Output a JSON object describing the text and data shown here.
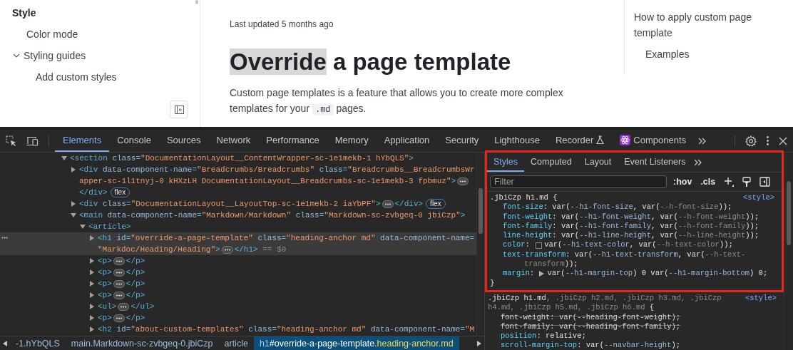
{
  "sidebar": {
    "section": "Style",
    "items": [
      {
        "label": "Color mode",
        "kind": "link"
      },
      {
        "label": "Styling guides",
        "kind": "group",
        "expanded": true,
        "children": [
          {
            "label": "Add custom styles"
          }
        ]
      }
    ]
  },
  "page": {
    "updated": "Last updated 5 months ago",
    "title_parts": [
      {
        "text": "Override",
        "selected": true
      },
      {
        "text": " a page template",
        "selected": false
      }
    ],
    "intro": [
      {
        "kind": "text",
        "text": "Custom page templates is a feature that allows you to create more complex templates for your "
      },
      {
        "kind": "code",
        "text": ".md"
      },
      {
        "kind": "text",
        "text": " pages."
      }
    ]
  },
  "toc": [
    {
      "label": "How to apply custom page template",
      "children": [
        {
          "label": "Examples"
        }
      ]
    }
  ],
  "devtools": {
    "tabs": [
      {
        "label": "Elements",
        "kind": "text",
        "selected": true
      },
      {
        "label": "Console",
        "kind": "text",
        "selected": false
      },
      {
        "label": "Sources",
        "kind": "text",
        "selected": false
      },
      {
        "label": "Network",
        "kind": "text",
        "selected": false
      },
      {
        "label": "Performance",
        "kind": "text",
        "selected": false
      },
      {
        "label": "Memory",
        "kind": "text",
        "selected": false
      },
      {
        "label": "Application",
        "kind": "text",
        "selected": false
      },
      {
        "label": "Security",
        "kind": "text",
        "selected": false
      },
      {
        "label": "Lighthouse",
        "kind": "text",
        "selected": false
      },
      {
        "label": "Recorder",
        "kind": "experimental",
        "selected": false
      },
      {
        "label": "Components",
        "kind": "extension",
        "selected": false
      }
    ],
    "tree": [
      {
        "expanded": true,
        "selected": false,
        "lines": [
          [
            {
              "kind": "tag",
              "text": "<section"
            },
            {
              "kind": "attr",
              "text": " class"
            },
            {
              "kind": "tag",
              "text": "="
            },
            {
              "kind": "value",
              "text": "\"DocumentationLayout__ContentWrapper-sc-1e1mekb-1 hYbQLS\""
            },
            {
              "kind": "tag",
              "text": ">"
            }
          ]
        ],
        "children": [
          {
            "expanded": false,
            "selected": false,
            "lines": [
              [
                {
                  "kind": "tag",
                  "text": "<div"
                },
                {
                  "kind": "attr",
                  "text": " data-component-name"
                },
                {
                  "kind": "tag",
                  "text": "="
                },
                {
                  "kind": "value",
                  "text": "\"Breadcrumbs/Breadcrumbs\""
                },
                {
                  "kind": "attr",
                  "text": " class"
                },
                {
                  "kind": "tag",
                  "text": "="
                },
                {
                  "kind": "value",
                  "text": "\"Breadcrumbs__BreadcrumbsWr"
                }
              ],
              [
                {
                  "kind": "value",
                  "text": "apper-sc-1l1tnyj-0 kHXzLH DocumentationLayout__Breadcrumbs-sc-1e1mekb-3 fpbmuz\""
                },
                {
                  "kind": "tag",
                  "text": ">"
                },
                {
                  "kind": "ellipsis"
                }
              ],
              [
                {
                  "kind": "tag",
                  "text": "</div>"
                },
                {
                  "kind": "badge",
                  "text": "flex"
                }
              ]
            ]
          },
          {
            "expanded": false,
            "selected": false,
            "lines": [
              [
                {
                  "kind": "tag",
                  "text": "<div"
                },
                {
                  "kind": "attr",
                  "text": " class"
                },
                {
                  "kind": "tag",
                  "text": "="
                },
                {
                  "kind": "value",
                  "text": "\"DocumentationLayout__LayoutTop-sc-1e1mekb-2 iaYbPF\""
                },
                {
                  "kind": "tag",
                  "text": ">"
                },
                {
                  "kind": "ellipsis"
                },
                {
                  "kind": "tag",
                  "text": "</div>"
                },
                {
                  "kind": "badge",
                  "text": "flex"
                }
              ]
            ]
          },
          {
            "expanded": true,
            "selected": false,
            "lines": [
              [
                {
                  "kind": "tag",
                  "text": "<main"
                },
                {
                  "kind": "attr",
                  "text": " data-component-name"
                },
                {
                  "kind": "tag",
                  "text": "="
                },
                {
                  "kind": "value",
                  "text": "\"Markdown/Markdown\""
                },
                {
                  "kind": "attr",
                  "text": " class"
                },
                {
                  "kind": "tag",
                  "text": "="
                },
                {
                  "kind": "value",
                  "text": "\"Markdown-sc-zvbgeq-0 jbiCzp\""
                },
                {
                  "kind": "tag",
                  "text": ">"
                }
              ]
            ],
            "children": [
              {
                "expanded": true,
                "selected": false,
                "lines": [
                  [
                    {
                      "kind": "tag",
                      "text": "<article>"
                    }
                  ]
                ],
                "children": [
                  {
                    "expanded": false,
                    "selected": true,
                    "lines": [
                      [
                        {
                          "kind": "tag",
                          "text": "<h1"
                        },
                        {
                          "kind": "attr",
                          "text": " id"
                        },
                        {
                          "kind": "tag",
                          "text": "="
                        },
                        {
                          "kind": "value",
                          "text": "\"override-a-page-template\""
                        },
                        {
                          "kind": "attr",
                          "text": " class"
                        },
                        {
                          "kind": "tag",
                          "text": "="
                        },
                        {
                          "kind": "value",
                          "text": "\"heading-anchor md\""
                        },
                        {
                          "kind": "attr",
                          "text": " data-component-name"
                        },
                        {
                          "kind": "tag",
                          "text": "="
                        }
                      ],
                      [
                        {
                          "kind": "value",
                          "text": "\"Markdoc/Heading/Heading\""
                        },
                        {
                          "kind": "tag",
                          "text": ">"
                        },
                        {
                          "kind": "ellipsis"
                        },
                        {
                          "kind": "tag",
                          "text": "</h1>"
                        },
                        {
                          "kind": "dim",
                          "text": " == $0"
                        }
                      ]
                    ]
                  },
                  {
                    "expanded": false,
                    "selected": false,
                    "lines": [
                      [
                        {
                          "kind": "tag",
                          "text": "<p>"
                        },
                        {
                          "kind": "ellipsis"
                        },
                        {
                          "kind": "tag",
                          "text": "</p>"
                        }
                      ]
                    ]
                  },
                  {
                    "expanded": false,
                    "selected": false,
                    "lines": [
                      [
                        {
                          "kind": "tag",
                          "text": "<p>"
                        },
                        {
                          "kind": "ellipsis"
                        },
                        {
                          "kind": "tag",
                          "text": "</p>"
                        }
                      ]
                    ]
                  },
                  {
                    "expanded": false,
                    "selected": false,
                    "lines": [
                      [
                        {
                          "kind": "tag",
                          "text": "<p>"
                        },
                        {
                          "kind": "ellipsis"
                        },
                        {
                          "kind": "tag",
                          "text": "</p>"
                        }
                      ]
                    ]
                  },
                  {
                    "expanded": false,
                    "selected": false,
                    "lines": [
                      [
                        {
                          "kind": "tag",
                          "text": "<p>"
                        },
                        {
                          "kind": "ellipsis"
                        },
                        {
                          "kind": "tag",
                          "text": "</p>"
                        }
                      ]
                    ]
                  },
                  {
                    "expanded": false,
                    "selected": false,
                    "lines": [
                      [
                        {
                          "kind": "tag",
                          "text": "<ul>"
                        },
                        {
                          "kind": "ellipsis"
                        },
                        {
                          "kind": "tag",
                          "text": "</ul>"
                        }
                      ]
                    ]
                  },
                  {
                    "expanded": false,
                    "selected": false,
                    "lines": [
                      [
                        {
                          "kind": "tag",
                          "text": "<p>"
                        },
                        {
                          "kind": "ellipsis"
                        },
                        {
                          "kind": "tag",
                          "text": "</p>"
                        }
                      ]
                    ]
                  },
                  {
                    "expanded": false,
                    "selected": false,
                    "lines": [
                      [
                        {
                          "kind": "tag",
                          "text": "<h2"
                        },
                        {
                          "kind": "attr",
                          "text": " id"
                        },
                        {
                          "kind": "tag",
                          "text": "="
                        },
                        {
                          "kind": "value",
                          "text": "\"about-custom-templates\""
                        },
                        {
                          "kind": "attr",
                          "text": " class"
                        },
                        {
                          "kind": "tag",
                          "text": "="
                        },
                        {
                          "kind": "value",
                          "text": "\"heading-anchor md\""
                        },
                        {
                          "kind": "attr",
                          "text": " data-component-name"
                        },
                        {
                          "kind": "tag",
                          "text": "="
                        },
                        {
                          "kind": "value",
                          "text": "\"M"
                        }
                      ]
                    ]
                  }
                ]
              }
            ]
          }
        ]
      }
    ],
    "breadcrumbs": [
      {
        "selected": false,
        "parts": [
          {
            "kind": "cls",
            "text": "-1.hYbQLS"
          }
        ]
      },
      {
        "selected": false,
        "parts": [
          {
            "kind": "tag",
            "text": "main"
          },
          {
            "kind": "cls",
            "text": ".Markdown-sc-zvbgeq-0.jbiCzp"
          }
        ]
      },
      {
        "selected": false,
        "parts": [
          {
            "kind": "tag",
            "text": "article"
          }
        ]
      },
      {
        "selected": true,
        "parts": [
          {
            "kind": "tag",
            "text": "h1"
          },
          {
            "kind": "id",
            "text": "#override-a-page-template"
          },
          {
            "kind": "cls",
            "text": ".heading-anchor.md"
          }
        ]
      }
    ],
    "styles": {
      "highlighted": true,
      "tabs": [
        {
          "label": "Styles",
          "selected": true
        },
        {
          "label": "Computed",
          "selected": false
        },
        {
          "label": "Layout",
          "selected": false
        },
        {
          "label": "Event Listeners",
          "selected": false
        }
      ],
      "filter": {
        "placeholder": "Filter"
      },
      "actions": [
        ":hov",
        ".cls"
      ],
      "rules": [
        {
          "source": "<style>",
          "selector_lines": [
            [
              {
                "kind": "match",
                "text": ".jbiCzp h1.md"
              },
              {
                "kind": "text",
                "text": " {"
              }
            ]
          ],
          "closing": "}",
          "declarations": [
            {
              "overridden": false,
              "lines": [
                [
                  {
                    "kind": "prop",
                    "text": "font-size"
                  },
                  {
                    "kind": "text",
                    "text": ": var("
                  },
                  {
                    "kind": "var",
                    "text": "--h1-font-size"
                  },
                  {
                    "kind": "text",
                    "text": ", var("
                  },
                  {
                    "kind": "dim",
                    "text": "--h-font-size"
                  },
                  {
                    "kind": "text",
                    "text": "));"
                  }
                ]
              ]
            },
            {
              "overridden": false,
              "lines": [
                [
                  {
                    "kind": "prop",
                    "text": "font-weight"
                  },
                  {
                    "kind": "text",
                    "text": ": var("
                  },
                  {
                    "kind": "var",
                    "text": "--h1-font-weight"
                  },
                  {
                    "kind": "text",
                    "text": ", var("
                  },
                  {
                    "kind": "dim",
                    "text": "--h-font-weight"
                  },
                  {
                    "kind": "text",
                    "text": "));"
                  }
                ]
              ]
            },
            {
              "overridden": false,
              "lines": [
                [
                  {
                    "kind": "prop",
                    "text": "font-family"
                  },
                  {
                    "kind": "text",
                    "text": ": var("
                  },
                  {
                    "kind": "var",
                    "text": "--h1-font-family"
                  },
                  {
                    "kind": "text",
                    "text": ", var("
                  },
                  {
                    "kind": "dim",
                    "text": "--h-font-family"
                  },
                  {
                    "kind": "text",
                    "text": "));"
                  }
                ]
              ]
            },
            {
              "overridden": false,
              "lines": [
                [
                  {
                    "kind": "prop",
                    "text": "line-height"
                  },
                  {
                    "kind": "text",
                    "text": ": var("
                  },
                  {
                    "kind": "var",
                    "text": "--h1-line-height"
                  },
                  {
                    "kind": "text",
                    "text": ", var("
                  },
                  {
                    "kind": "dim",
                    "text": "--h-line-height"
                  },
                  {
                    "kind": "text",
                    "text": "));"
                  }
                ]
              ]
            },
            {
              "overridden": false,
              "lines": [
                [
                  {
                    "kind": "prop",
                    "text": "color"
                  },
                  {
                    "kind": "text",
                    "text": ": "
                  },
                  {
                    "kind": "swatch"
                  },
                  {
                    "kind": "text",
                    "text": "var("
                  },
                  {
                    "kind": "var",
                    "text": "--h1-text-color"
                  },
                  {
                    "kind": "text",
                    "text": ", var("
                  },
                  {
                    "kind": "dim",
                    "text": "--h-text-color"
                  },
                  {
                    "kind": "text",
                    "text": "));"
                  }
                ]
              ]
            },
            {
              "overridden": false,
              "lines": [
                [
                  {
                    "kind": "prop",
                    "text": "text-transform"
                  },
                  {
                    "kind": "text",
                    "text": ": var("
                  },
                  {
                    "kind": "var",
                    "text": "--h1-text-transform"
                  },
                  {
                    "kind": "text",
                    "text": ", var("
                  },
                  {
                    "kind": "dim",
                    "text": "--h-text-"
                  }
                ],
                [
                  {
                    "kind": "dim",
                    "text": "transform"
                  },
                  {
                    "kind": "text",
                    "text": "));"
                  }
                ]
              ]
            },
            {
              "overridden": false,
              "lines": [
                [
                  {
                    "kind": "prop",
                    "text": "margin"
                  },
                  {
                    "kind": "text",
                    "text": ": "
                  },
                  {
                    "kind": "arrow"
                  },
                  {
                    "kind": "text",
                    "text": "var("
                  },
                  {
                    "kind": "var",
                    "text": "--h1-margin-top"
                  },
                  {
                    "kind": "text",
                    "text": ") 0 var("
                  },
                  {
                    "kind": "var",
                    "text": "--h1-margin-bottom"
                  },
                  {
                    "kind": "text",
                    "text": ") 0;"
                  }
                ]
              ]
            }
          ]
        },
        {
          "source": "<style>",
          "selector_lines": [
            [
              {
                "kind": "match",
                "text": ".jbiCzp h1.md"
              },
              {
                "kind": "nomatch",
                "text": ", .jbiCzp h2.md, .jbiCzp h3.md, .jbiCzp"
              }
            ],
            [
              {
                "kind": "nomatch",
                "text": "h4.md, .jbiCzp h5.md, .jbiCzp h6.md"
              },
              {
                "kind": "text",
                "text": " {"
              }
            ]
          ],
          "declarations": [
            {
              "overridden": true,
              "lines": [
                [
                  {
                    "kind": "prop",
                    "text": "font-weight"
                  },
                  {
                    "kind": "text",
                    "text": ": var("
                  },
                  {
                    "kind": "var",
                    "text": "--heading-font-weight"
                  },
                  {
                    "kind": "text",
                    "text": ");"
                  }
                ]
              ]
            },
            {
              "overridden": true,
              "lines": [
                [
                  {
                    "kind": "prop",
                    "text": "font-family"
                  },
                  {
                    "kind": "text",
                    "text": ": var("
                  },
                  {
                    "kind": "var",
                    "text": "--heading-font-family"
                  },
                  {
                    "kind": "text",
                    "text": ");"
                  }
                ]
              ]
            },
            {
              "overridden": false,
              "lines": [
                [
                  {
                    "kind": "prop",
                    "text": "position"
                  },
                  {
                    "kind": "text",
                    "text": ": relative;"
                  }
                ]
              ]
            },
            {
              "overridden": false,
              "lines": [
                [
                  {
                    "kind": "prop",
                    "text": "scroll-margin-top"
                  },
                  {
                    "kind": "text",
                    "text": ": var("
                  },
                  {
                    "kind": "var",
                    "text": "--navbar-height"
                  },
                  {
                    "kind": "text",
                    "text": ");"
                  }
                ]
              ]
            }
          ]
        }
      ]
    }
  }
}
